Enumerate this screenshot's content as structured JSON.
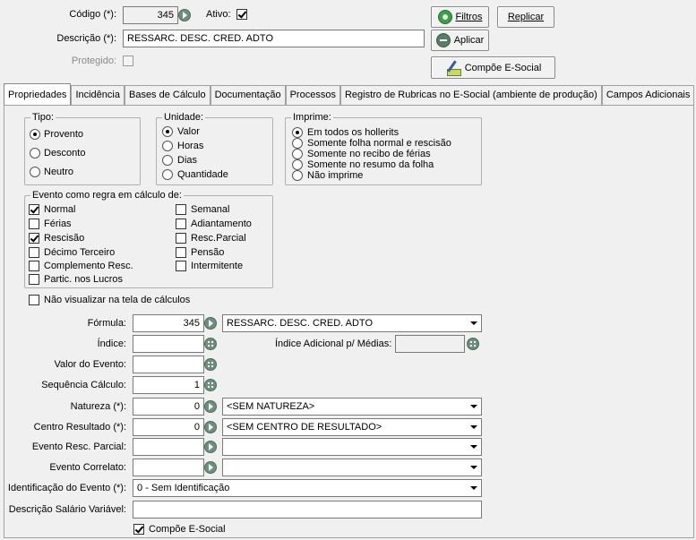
{
  "header": {
    "codigo_label": "Código (*):",
    "codigo_value": "345",
    "ativo_label": "Ativo:",
    "ativo_checked": true,
    "descricao_label": "Descrição (*):",
    "descricao_value": "RESSARC. DESC. CRED. ADTO",
    "protegido_label": "Protegido:",
    "protegido_checked": false
  },
  "buttons": {
    "filtros": "Filtros",
    "replicar": "Replicar",
    "aplicar": "Aplicar",
    "compoe_esocial": "Compõe E-Social"
  },
  "tabs": [
    {
      "label": "Propriedades",
      "active": true
    },
    {
      "label": "Incidência"
    },
    {
      "label": "Bases de Cálculo"
    },
    {
      "label": "Documentação"
    },
    {
      "label": "Processos"
    },
    {
      "label": "Registro de Rubricas no E-Social (ambiente de produção)"
    },
    {
      "label": "Campos Adicionais"
    }
  ],
  "tipo": {
    "caption": "Tipo:",
    "options": [
      "Provento",
      "Desconto",
      "Neutro"
    ],
    "selected": 0
  },
  "unidade": {
    "caption": "Unidade:",
    "options": [
      "Valor",
      "Horas",
      "Dias",
      "Quantidade"
    ],
    "selected": 0
  },
  "imprime": {
    "caption": "Imprime:",
    "options": [
      "Em todos os hollerits",
      "Somente folha normal e rescisão",
      "Somente no recibo de férias",
      "Somente no resumo da folha",
      "Não imprime"
    ],
    "selected": 0
  },
  "evento": {
    "caption": "Evento como regra em cálculo de:",
    "left": [
      {
        "label": "Normal",
        "checked": true
      },
      {
        "label": "Férias",
        "checked": false
      },
      {
        "label": "Rescisão",
        "checked": true
      },
      {
        "label": "Décimo Terceiro",
        "checked": false
      },
      {
        "label": "Complemento Resc.",
        "checked": false
      },
      {
        "label": "Partic. nos Lucros",
        "checked": false
      }
    ],
    "right": [
      {
        "label": "Semanal",
        "checked": false
      },
      {
        "label": "Adiantamento",
        "checked": false
      },
      {
        "label": "Resc.Parcial",
        "checked": false
      },
      {
        "label": "Pensão",
        "checked": false
      },
      {
        "label": "Intermitente",
        "checked": false
      }
    ]
  },
  "nao_visualizar": {
    "label": "Não visualizar na tela de cálculos",
    "checked": false
  },
  "fields": {
    "formula_label": "Fórmula:",
    "formula_code": "345",
    "formula_desc": "RESSARC. DESC. CRED. ADTO",
    "indice_label": "Índice:",
    "indice_value": "",
    "indice_adic_label": "Índice Adicional p/ Médias:",
    "indice_adic_value": "",
    "valor_evento_label": "Valor do Evento:",
    "valor_evento_value": "",
    "sequencia_label": "Sequência Cálculo:",
    "sequencia_value": "1",
    "natureza_label": "Natureza (*):",
    "natureza_code": "0",
    "natureza_desc": "<SEM NATUREZA>",
    "centro_label": "Centro Resultado (*):",
    "centro_code": "0",
    "centro_desc": "<SEM CENTRO DE RESULTADO>",
    "resc_parcial_label": "Evento Resc. Parcial:",
    "resc_parcial_code": "",
    "resc_parcial_desc": "",
    "correlato_label": "Evento Correlato:",
    "correlato_code": "",
    "correlato_desc": "",
    "identificacao_label": "Identificação do Evento (*):",
    "identificacao_value": "0 - Sem Identificação",
    "desc_salario_label": "Descrição Salário Variável:",
    "desc_salario_value": ""
  },
  "compoe_esocial_check": {
    "label": "Compõe E-Social",
    "checked": true
  }
}
